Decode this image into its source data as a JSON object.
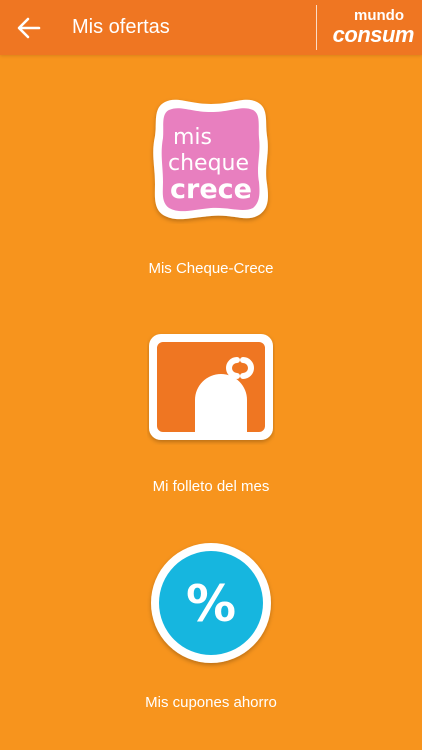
{
  "header": {
    "back_icon": "arrow-left-icon",
    "title": "Mis ofertas",
    "brand_top": "mundo",
    "brand_bottom": "consum"
  },
  "menu": {
    "items": [
      {
        "label": "Mis Cheque-Crece",
        "icon": "cheque-crece-logo",
        "icon_text": [
          "mis",
          "cheque",
          "crece"
        ]
      },
      {
        "label": "Mi folleto del mes",
        "icon": "folleto-icon"
      },
      {
        "label": "Mis cupones ahorro",
        "icon": "percent-coupon-icon",
        "icon_text": "%"
      }
    ]
  },
  "colors": {
    "background": "#f7941d",
    "header": "#ef7622",
    "cheque_pink": "#e87fbf",
    "folleto_orange": "#ef7622",
    "cupon_blue": "#16b6df"
  }
}
